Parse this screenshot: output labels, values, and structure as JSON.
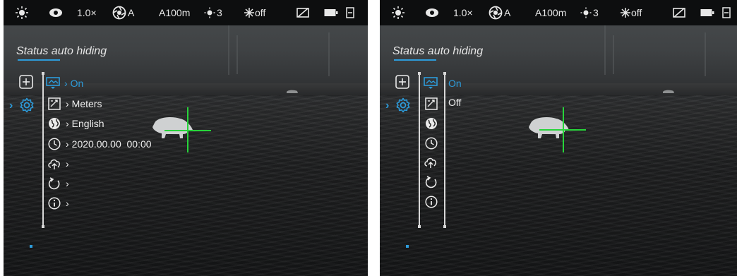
{
  "status_bar": {
    "zoom": "1.0×",
    "calibration": "A",
    "range": "A100m",
    "brightness_level": "3",
    "ir": "off"
  },
  "menu": {
    "title": "Status auto hiding",
    "items": [
      {
        "icon": "status-hide-icon",
        "value": "On"
      },
      {
        "icon": "units-icon",
        "value": "Meters"
      },
      {
        "icon": "globe-icon",
        "value": "English"
      },
      {
        "icon": "clock-icon",
        "value": "2020.00.00  00:00"
      },
      {
        "icon": "cloud-upload-icon",
        "value": ""
      },
      {
        "icon": "reset-icon",
        "value": ""
      },
      {
        "icon": "info-icon",
        "value": ""
      }
    ],
    "submenu_options": [
      "On",
      "Off"
    ],
    "colors": {
      "accent": "#2d9cdb",
      "reticle": "#27d43a"
    }
  }
}
